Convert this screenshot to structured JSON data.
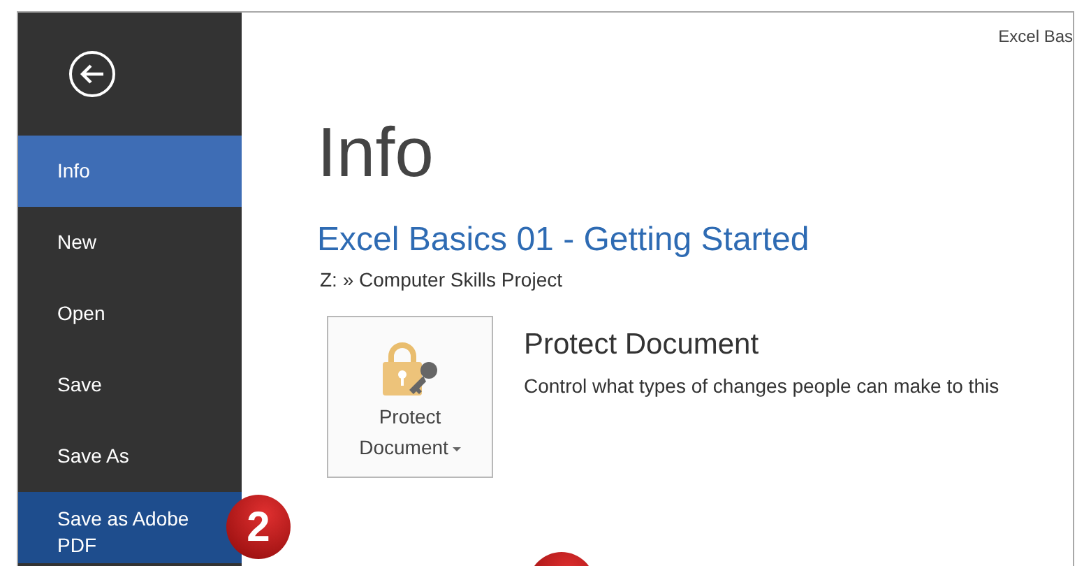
{
  "window": {
    "title": "Excel Bas"
  },
  "sidebar": {
    "items": [
      {
        "label": "Info",
        "selected": true,
        "highlighted": false
      },
      {
        "label": "New",
        "selected": false,
        "highlighted": false
      },
      {
        "label": "Open",
        "selected": false,
        "highlighted": false
      },
      {
        "label": "Save",
        "selected": false,
        "highlighted": false
      },
      {
        "label": "Save As",
        "selected": false,
        "highlighted": false
      },
      {
        "label": "Save as Adobe PDF",
        "selected": false,
        "highlighted": true
      }
    ]
  },
  "page": {
    "heading": "Info",
    "document_title": "Excel Basics 01 - Getting Started",
    "path": "Z: » Computer Skills Project",
    "protect": {
      "button_label": "Protect Document",
      "title": "Protect Document",
      "description": "Control what types of changes people can make to this"
    }
  },
  "callouts": [
    {
      "label": "2"
    }
  ]
}
